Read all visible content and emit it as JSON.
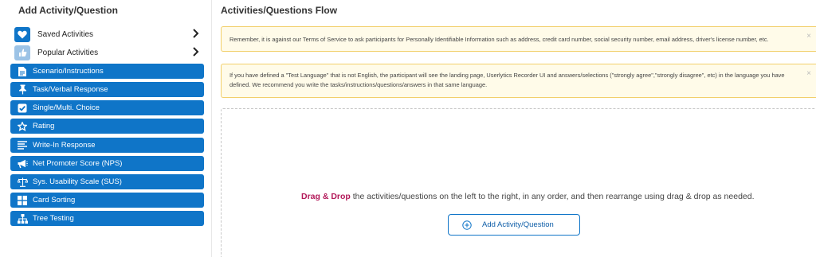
{
  "left_panel": {
    "title": "Add Activity/Question",
    "saved": [
      {
        "label": "Saved Activities",
        "icon": "heart-icon",
        "icon_bg": "#0f75c8"
      },
      {
        "label": "Popular Activities",
        "icon": "thumbs-up-icon",
        "icon_bg": "#9cc3e6"
      }
    ],
    "activities": [
      {
        "label": "Scenario/Instructions",
        "icon": "document-icon"
      },
      {
        "label": "Task/Verbal Response",
        "icon": "pin-icon"
      },
      {
        "label": "Single/Multi. Choice",
        "icon": "checkbox-icon"
      },
      {
        "label": "Rating",
        "icon": "star-icon"
      },
      {
        "label": "Write-In Response",
        "icon": "text-lines-icon"
      },
      {
        "label": "Net Promoter Score (NPS)",
        "icon": "megaphone-icon"
      },
      {
        "label": "Sys. Usability Scale (SUS)",
        "icon": "scale-icon"
      },
      {
        "label": "Card Sorting",
        "icon": "grid-icon"
      },
      {
        "label": "Tree Testing",
        "icon": "sitemap-icon"
      }
    ]
  },
  "right_panel": {
    "title": "Activities/Questions Flow",
    "notices": [
      {
        "text": "Remember, it is against our Terms of Service to ask participants for Personally Identifiable Information such as address, credit card number, social security number, email address, driver's license number, etc."
      },
      {
        "text": "If you have defined a \"Test Language\" that is not English, the participant will see the landing page, Userlytics Recorder UI and answers/selections (\"strongly agree\",\"strongly disagree\", etc) in the language you have defined. We recommend you write the tasks/instructions/questions/answers in that same language."
      }
    ],
    "close_glyph": "×",
    "drop_highlight": "Drag & Drop",
    "drop_text": " the activities/questions on the left to the right, in any order, and then rearrange using drag & drop as needed.",
    "add_button_label": "Add Activity/Question"
  },
  "colors": {
    "accent": "#0f75c8",
    "highlight": "#b3195a",
    "notice_bg": "#fffbe9",
    "notice_border": "#f2cf6a"
  }
}
